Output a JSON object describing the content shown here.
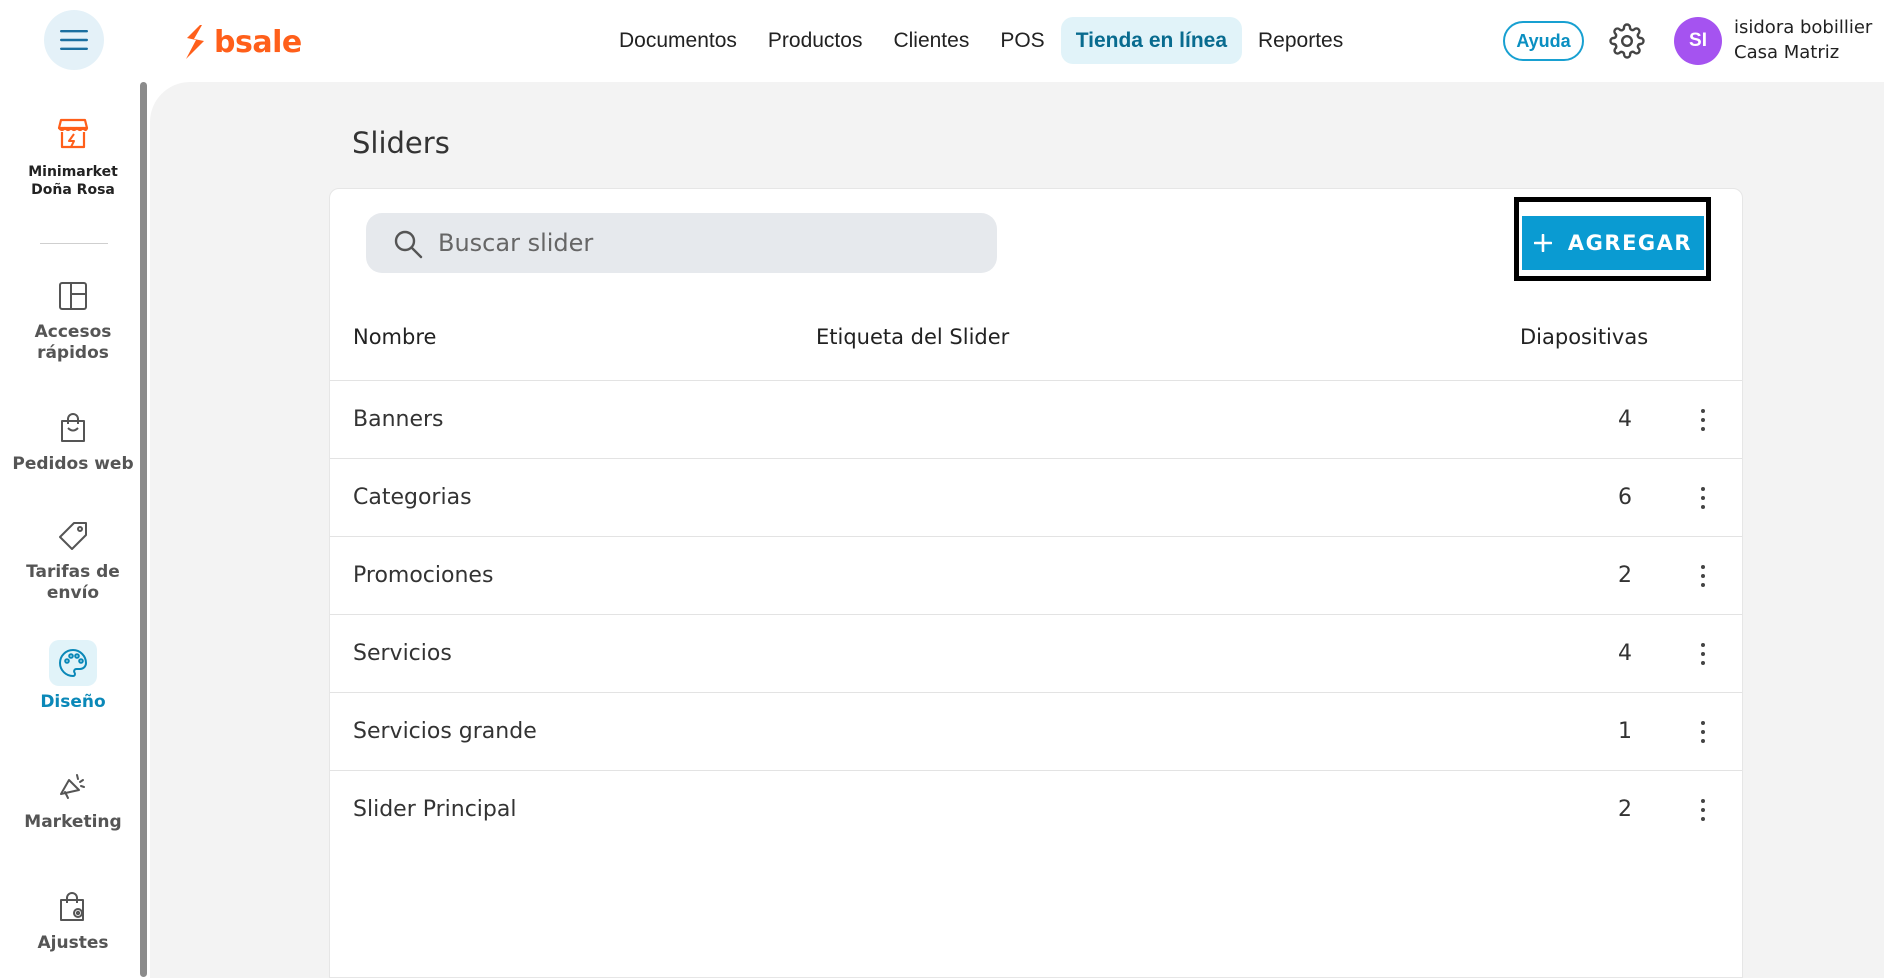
{
  "brand": {
    "logo_text": "bsale",
    "accent": "#ff5f1a",
    "primary": "#0a9bd2"
  },
  "nav": {
    "items": [
      {
        "label": "Documentos"
      },
      {
        "label": "Productos"
      },
      {
        "label": "Clientes"
      },
      {
        "label": "POS"
      },
      {
        "label": "Tienda en línea",
        "active": true
      },
      {
        "label": "Reportes"
      }
    ]
  },
  "header": {
    "help_label": "Ayuda",
    "user_initials": "SI",
    "user_name": "isidora bobillier",
    "user_branch": "Casa Matriz"
  },
  "sidebar": {
    "store_name_line1": "Minimarket",
    "store_name_line2": "Doña Rosa",
    "items": [
      {
        "label_line1": "Accesos",
        "label_line2": "rápidos",
        "icon": "layout-icon"
      },
      {
        "label_line1": "Pedidos web",
        "label_line2": "",
        "icon": "shopping-bag-icon"
      },
      {
        "label_line1": "Tarifas de",
        "label_line2": "envío",
        "icon": "tag-icon"
      },
      {
        "label_line1": "Diseño",
        "label_line2": "",
        "icon": "palette-icon",
        "active": true
      },
      {
        "label_line1": "Marketing",
        "label_line2": "",
        "icon": "megaphone-icon"
      },
      {
        "label_line1": "Ajustes",
        "label_line2": "",
        "icon": "bag-settings-icon"
      }
    ]
  },
  "page": {
    "title": "Sliders",
    "search_placeholder": "Buscar slider",
    "search_value": "",
    "add_button_label": "AGREGAR",
    "columns": {
      "name": "Nombre",
      "label": "Etiqueta del Slider",
      "slides": "Diapositivas"
    },
    "rows": [
      {
        "name": "Banners",
        "label": "",
        "slides": "4"
      },
      {
        "name": "Categorias",
        "label": "",
        "slides": "6"
      },
      {
        "name": "Promociones",
        "label": "",
        "slides": "2"
      },
      {
        "name": "Servicios",
        "label": "",
        "slides": "4"
      },
      {
        "name": "Servicios grande",
        "label": "",
        "slides": "1"
      },
      {
        "name": "Slider Principal",
        "label": "",
        "slides": "2"
      }
    ]
  }
}
